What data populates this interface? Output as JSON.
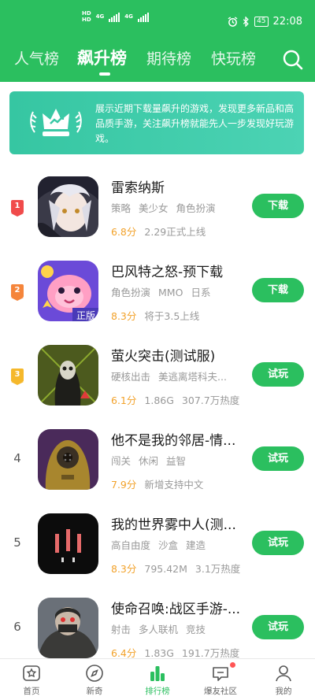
{
  "status_bar": {
    "sim1": "HD",
    "sim2": "HD",
    "net1": "4G",
    "net2": "4G",
    "battery": "45",
    "time": "22:08"
  },
  "tabs": [
    {
      "label": "人气榜"
    },
    {
      "label": "飙升榜"
    },
    {
      "label": "期待榜"
    },
    {
      "label": "快玩榜"
    }
  ],
  "banner": {
    "text": "展示近期下载量飙升的游戏，发现更多新品和高品质手游，关注飙升榜就能先人一步发现好玩游戏。"
  },
  "games": [
    {
      "rank": "1",
      "title": "雷索纳斯",
      "tags": [
        "策略",
        "美少女",
        "角色扮演"
      ],
      "score": "6.8分",
      "meta": [
        "2.29正式上线"
      ],
      "action": "下载",
      "badge_color": "#f04b4b"
    },
    {
      "rank": "2",
      "title": "巴风特之怒-预下载",
      "tags": [
        "角色扮演",
        "MMO",
        "日系"
      ],
      "score": "8.3分",
      "meta": [
        "将于3.5上线"
      ],
      "action": "下载",
      "badge_color": "#f5853b"
    },
    {
      "rank": "3",
      "title": "萤火突击(测试服)",
      "tags": [
        "硬核出击",
        "美逃离塔科夫..."
      ],
      "score": "6.1分",
      "meta": [
        "1.86G",
        "307.7万热度"
      ],
      "action": "试玩",
      "badge_color": "#f5b82b"
    },
    {
      "rank": "4",
      "title": "他不是我的邻居-情...",
      "tags": [
        "闯关",
        "休闲",
        "益智"
      ],
      "score": "7.9分",
      "meta": [
        "新增支持中文"
      ],
      "action": "试玩"
    },
    {
      "rank": "5",
      "title": "我的世界雾中人(测...",
      "tags": [
        "高自由度",
        "沙盒",
        "建造"
      ],
      "score": "8.3分",
      "meta": [
        "795.42M",
        "3.1万热度"
      ],
      "action": "试玩"
    },
    {
      "rank": "6",
      "title": "使命召唤:战区手游-...",
      "tags": [
        "射击",
        "多人联机",
        "竞技"
      ],
      "score": "6.4分",
      "meta": [
        "1.83G",
        "191.7万热度"
      ],
      "action": "试玩"
    }
  ],
  "bottom_nav": [
    {
      "label": "首页",
      "icon": "star-icon"
    },
    {
      "label": "新奇",
      "icon": "compass-icon"
    },
    {
      "label": "排行榜",
      "icon": "bar-chart-icon"
    },
    {
      "label": "爆友社区",
      "icon": "chat-bubble-icon"
    },
    {
      "label": "我的",
      "icon": "person-icon"
    }
  ],
  "colors": {
    "brand": "#2bbf5f",
    "score": "#f2a22b",
    "notify": "#ff5555"
  }
}
